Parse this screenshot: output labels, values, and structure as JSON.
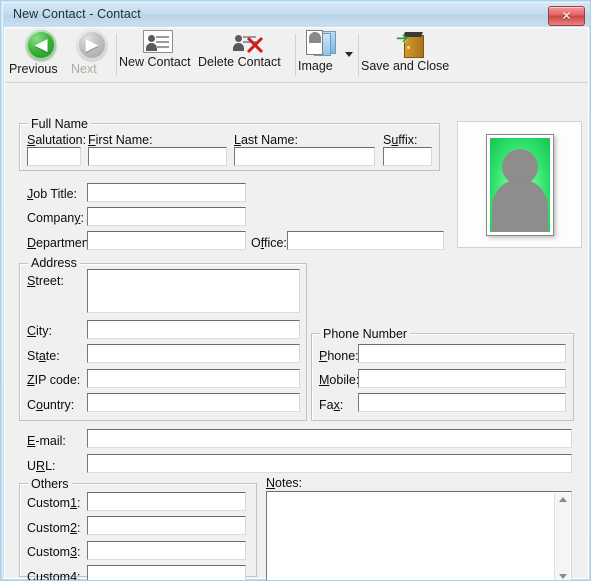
{
  "window": {
    "title": "New Contact - Contact",
    "close_label": "✕",
    "accent_title_color": "#b9d4ea",
    "close_button_color": "#cf4343"
  },
  "toolbar": {
    "items": [
      {
        "label": "Previous",
        "icon": "back-arrow-icon",
        "enabled": true
      },
      {
        "label": "Next",
        "icon": "forward-arrow-icon",
        "enabled": false
      },
      {
        "label": "New Contact",
        "icon": "contact-card-icon",
        "enabled": true
      },
      {
        "label": "Delete Contact",
        "icon": "contact-card-delete-icon",
        "enabled": true
      },
      {
        "label": "Image",
        "icon": "image-stack-icon",
        "enabled": true,
        "has_dropdown": true
      },
      {
        "label": "Save and Close",
        "icon": "save-and-close-door-icon",
        "enabled": true
      }
    ],
    "back_arrow_glyph": "◀",
    "forward_arrow_glyph": "▶",
    "save_arrow_glyph": "➔"
  },
  "groups": {
    "full_name": "Full Name",
    "address": "Address",
    "phone_number": "Phone Number",
    "others": "Others"
  },
  "fields": {
    "salutation": {
      "label": "Salutation:",
      "accel": "S",
      "value": ""
    },
    "first_name": {
      "label": "First Name:",
      "accel": "F",
      "value": ""
    },
    "last_name": {
      "label": "Last Name:",
      "accel": "L",
      "value": ""
    },
    "suffix": {
      "label": "Suffix:",
      "accel": "u",
      "value": ""
    },
    "job_title": {
      "label": "Job Title:",
      "accel": "J",
      "value": ""
    },
    "company": {
      "label": "Company:",
      "accel": "y",
      "value": ""
    },
    "department": {
      "label": "Department:",
      "accel": "D",
      "value": ""
    },
    "office": {
      "label": "Office:",
      "accel": "f",
      "value": ""
    },
    "street": {
      "label": "Street:",
      "accel": "S",
      "value": ""
    },
    "city": {
      "label": "City:",
      "accel": "C",
      "value": ""
    },
    "state": {
      "label": "State:",
      "accel": "a",
      "value": ""
    },
    "zip_code": {
      "label": "ZIP code:",
      "accel": "Z",
      "value": ""
    },
    "country": {
      "label": "Country:",
      "accel": "o",
      "value": ""
    },
    "phone": {
      "label": "Phone:",
      "accel": "P",
      "value": ""
    },
    "mobile": {
      "label": "Mobile:",
      "accel": "M",
      "value": ""
    },
    "fax": {
      "label": "Fax:",
      "accel": "x",
      "value": ""
    },
    "email": {
      "label": "E-mail:",
      "accel": "E",
      "value": ""
    },
    "url": {
      "label": "URL:",
      "accel": "R",
      "value": ""
    },
    "custom1": {
      "label": "Custom1:",
      "accel": "1",
      "value": ""
    },
    "custom2": {
      "label": "Custom2:",
      "accel": "2",
      "value": ""
    },
    "custom3": {
      "label": "Custom3:",
      "accel": "3",
      "value": ""
    },
    "custom4": {
      "label": "Custom4:",
      "accel": "4",
      "value": ""
    },
    "notes": {
      "label": "Notes:",
      "accel": "N",
      "value": ""
    }
  },
  "avatar": {
    "name": "contact-photo-placeholder",
    "background_color": "#2ee06a",
    "silhouette_color": "#8d8d8d"
  }
}
